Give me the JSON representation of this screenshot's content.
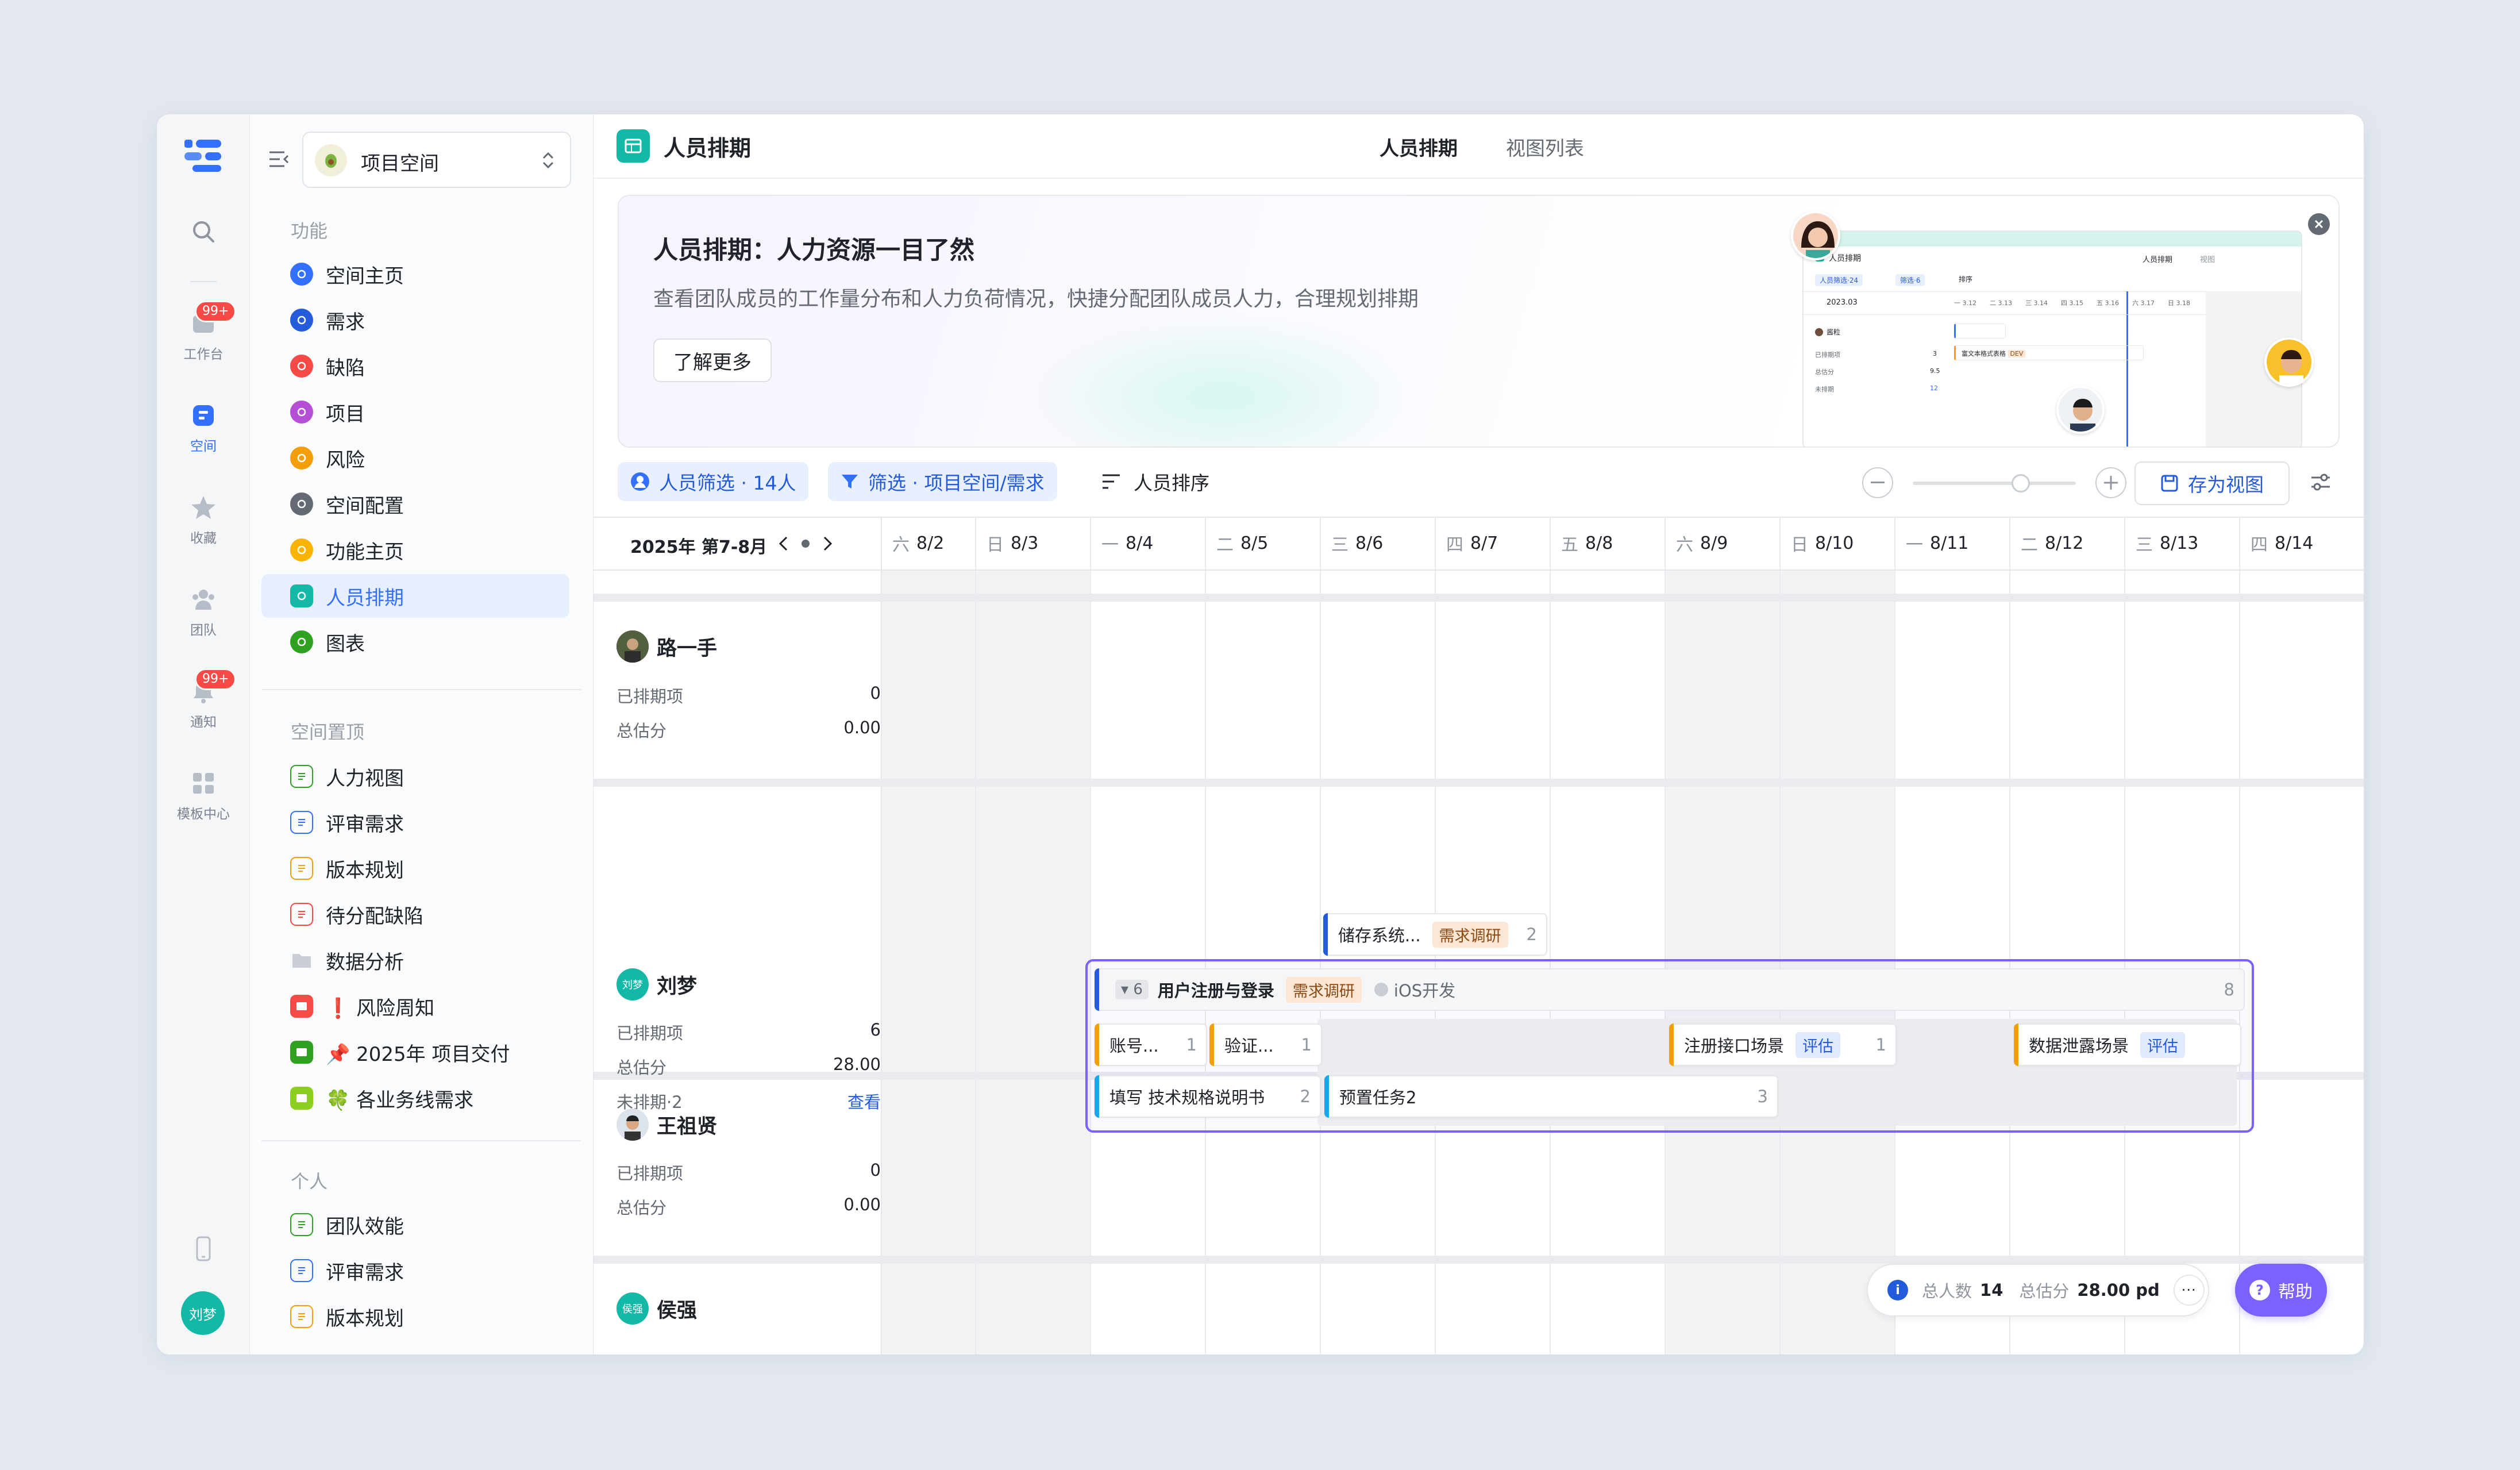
{
  "rail": {
    "items": [
      {
        "label": "工作台",
        "badge": "99+"
      },
      {
        "label": "空间"
      },
      {
        "label": "收藏"
      },
      {
        "label": "团队"
      },
      {
        "label": "通知",
        "badge": "99+"
      },
      {
        "label": "模板中心"
      }
    ],
    "user_avatar": "刘梦"
  },
  "sidebar": {
    "space_name": "项目空间",
    "section_func": "功能",
    "func_items": [
      "空间主页",
      "需求",
      "缺陷",
      "项目",
      "风险",
      "空间配置",
      "功能主页",
      "人员排期",
      "图表"
    ],
    "section_pinned": "空间置顶",
    "pinned_items": [
      "人力视图",
      "评审需求",
      "版本规划",
      "待分配缺陷",
      "数据分析",
      "❗ 风险周知",
      "📌 2025年 项目交付",
      "🍀 各业务线需求"
    ],
    "section_personal": "个人",
    "personal_items": [
      "团队效能",
      "评审需求",
      "版本规划"
    ]
  },
  "header": {
    "title": "人员排期",
    "tab_active": "人员排期",
    "tab_other": "视图列表"
  },
  "banner": {
    "title": "人员排期：人力资源一目了然",
    "desc": "查看团队成员的工作量分布和人力负荷情况，快捷分配团队成员人力，合理规划排期",
    "button": "了解更多"
  },
  "toolbar": {
    "member_filter": "人员筛选 · 14人",
    "filter": "筛选 · 项目空间/需求",
    "sort": "人员排序",
    "save_view": "存为视图"
  },
  "calendar": {
    "period": "2025年 第7-8月",
    "days": [
      {
        "wd": "六",
        "d": "8/2"
      },
      {
        "wd": "日",
        "d": "8/3"
      },
      {
        "wd": "一",
        "d": "8/4"
      },
      {
        "wd": "二",
        "d": "8/5"
      },
      {
        "wd": "三",
        "d": "8/6"
      },
      {
        "wd": "四",
        "d": "8/7"
      },
      {
        "wd": "五",
        "d": "8/8"
      },
      {
        "wd": "六",
        "d": "8/9"
      },
      {
        "wd": "日",
        "d": "8/10"
      },
      {
        "wd": "一",
        "d": "8/11"
      },
      {
        "wd": "二",
        "d": "8/12"
      },
      {
        "wd": "三",
        "d": "8/13"
      },
      {
        "wd": "四",
        "d": "8/14"
      }
    ]
  },
  "stat_labels": {
    "scheduled": "已排期项",
    "estimate": "总估分",
    "unscheduled": "未排期·2",
    "view": "查看"
  },
  "people": [
    {
      "name": "路一手",
      "scheduled": "0",
      "estimate": "0.00"
    },
    {
      "name": "刘梦",
      "avatar": "刘梦",
      "scheduled": "6",
      "estimate": "28.00"
    },
    {
      "name": "王祖贤",
      "scheduled": "0",
      "estimate": "0.00"
    },
    {
      "name": "侯强",
      "avatar": "侯强"
    }
  ],
  "tasks": {
    "t1": {
      "name": "储存系统...",
      "tag": "需求调研",
      "num": "2"
    },
    "group": {
      "count": "6",
      "name": "用户注册与登录",
      "tag": "需求调研",
      "status": "iOS开发",
      "num": "8"
    },
    "t2": {
      "name": "账号...",
      "num": "1"
    },
    "t3": {
      "name": "验证...",
      "num": "1"
    },
    "t4": {
      "name": "注册接口场景",
      "tag": "评估",
      "num": "1"
    },
    "t5": {
      "name": "数据泄露场景",
      "tag": "评估"
    },
    "t6": {
      "name": "填写 技术规格说明书",
      "num": "2"
    },
    "t7": {
      "name": "预置任务2",
      "num": "3"
    }
  },
  "summary": {
    "total_people_label": "总人数",
    "total_people": "14",
    "total_est_label": "总估分",
    "total_est": "28.00 pd"
  },
  "help": "帮助",
  "preview": {
    "title": "人员排期",
    "tab1": "人员排期",
    "tab2": "视图",
    "f1": "人员筛选·24",
    "f2": "筛选·6",
    "f3": "排序",
    "period": "2023.03",
    "days": [
      "一 3.12",
      "二 3.13",
      "三 3.14",
      "四 3.15",
      "五 3.16",
      "六 3.17",
      "日 3.18"
    ],
    "person": "酱粒",
    "r1": "已排期项",
    "v1": "3",
    "r2": "总估分",
    "v2": "9.5",
    "r3": "未排期",
    "v3": "12",
    "task": "富文本格式表格",
    "task_tag": "DEV"
  }
}
